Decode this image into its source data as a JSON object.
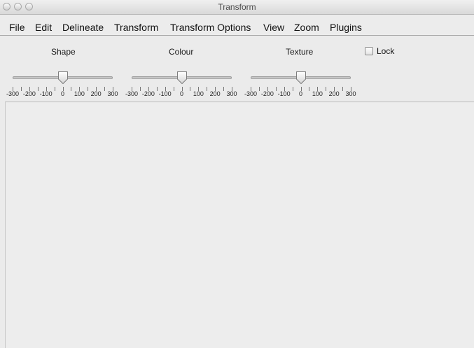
{
  "window": {
    "title": "Transform"
  },
  "menu": [
    "File",
    "Edit",
    "Delineate",
    "Transform",
    "Transform Options",
    "View",
    "Zoom",
    "Plugins"
  ],
  "controls": {
    "shape": {
      "label": "Shape",
      "value": 0
    },
    "colour": {
      "label": "Colour",
      "value": 0
    },
    "texture": {
      "label": "Texture",
      "value": 0
    },
    "lock": {
      "label": "Lock",
      "checked": false
    }
  },
  "slider_scale": {
    "min": -300,
    "max": 300,
    "tick_labels": [
      "-300",
      "-200",
      "-100",
      "0",
      "100",
      "200",
      "300"
    ]
  },
  "icons": {
    "window_buttons": [
      "close-icon",
      "minimize-icon",
      "zoom-icon"
    ],
    "slider_thumb": "slider-thumb-icon"
  }
}
